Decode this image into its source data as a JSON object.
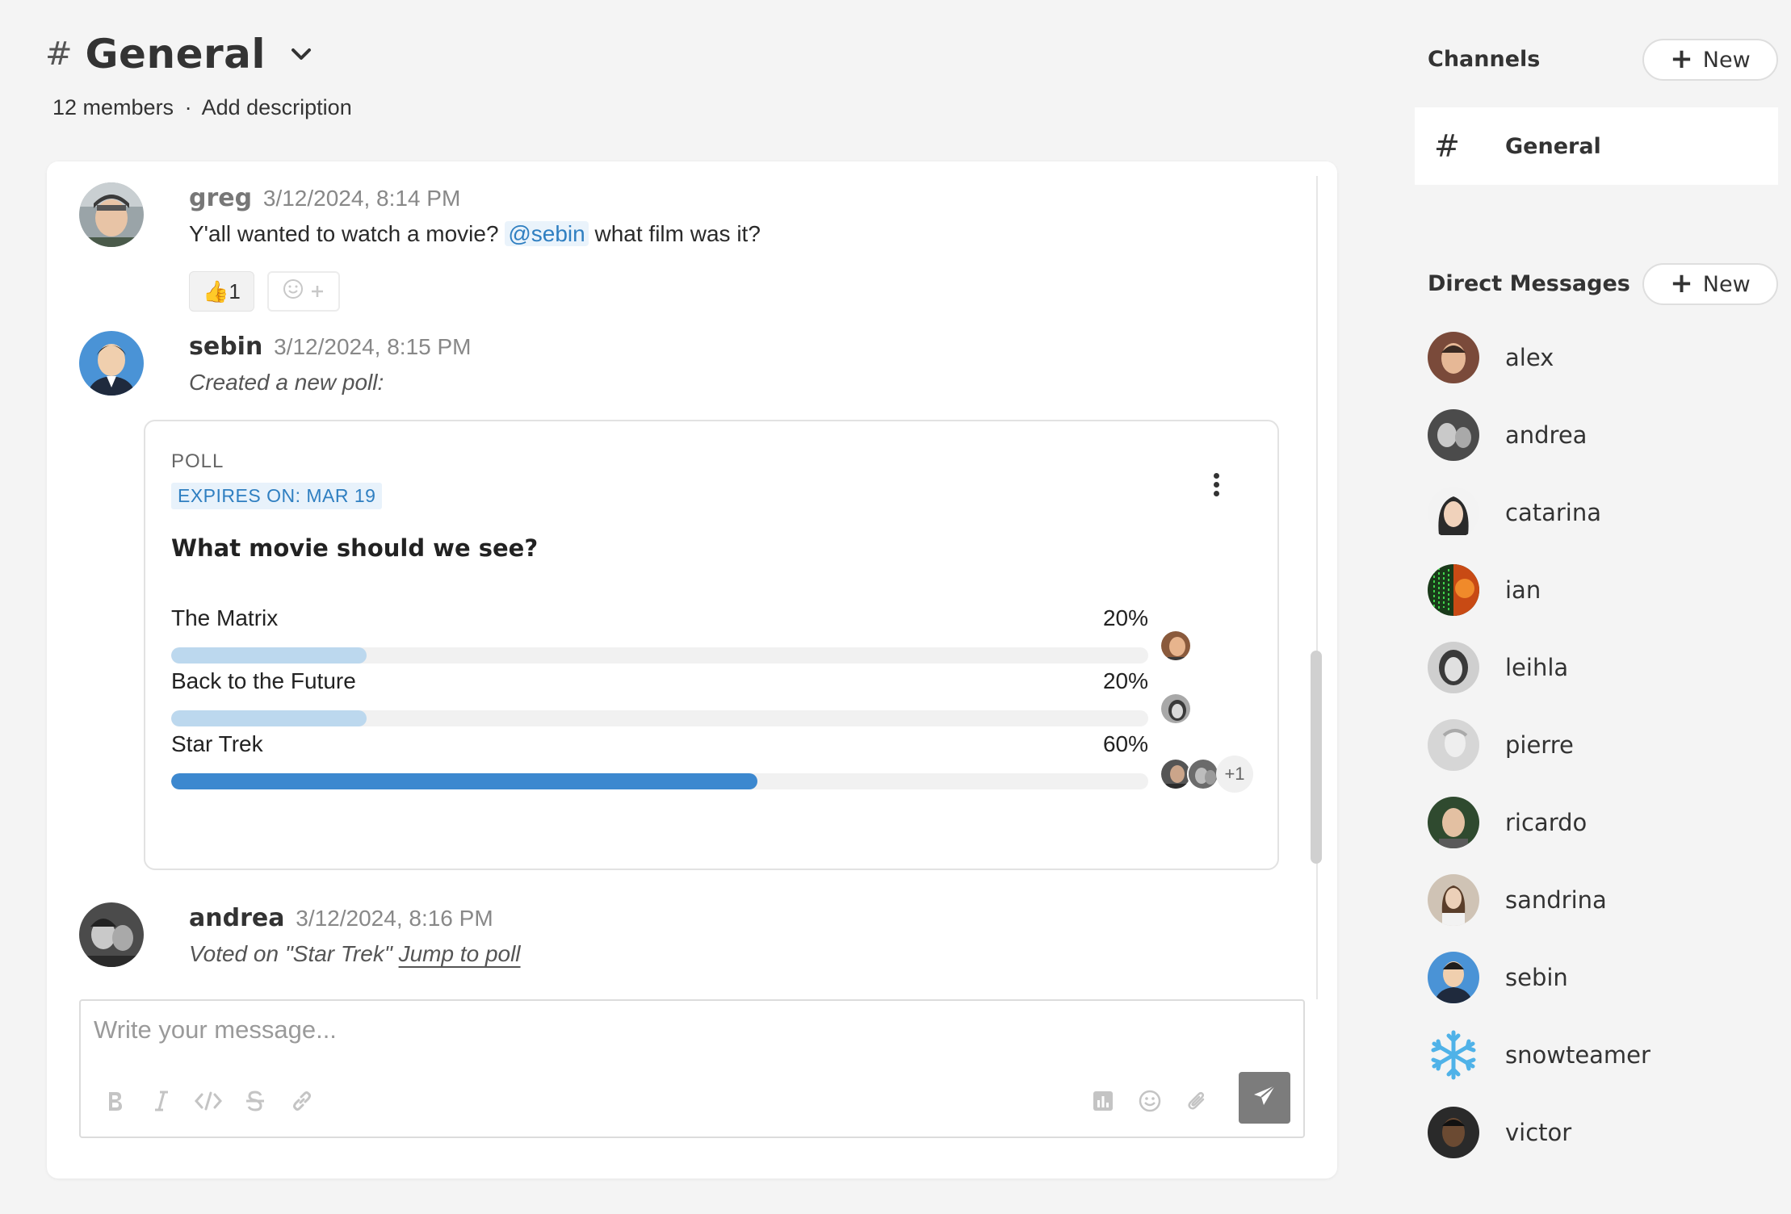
{
  "channel": {
    "hash": "#",
    "name": "General",
    "members": "12 members",
    "separator": "·",
    "add_description": "Add description"
  },
  "messages": [
    {
      "author": "greg",
      "timestamp": "3/12/2024, 8:14 PM",
      "text_before": "Y'all wanted to watch a movie?",
      "mention": "@sebin",
      "text_after": "what film was it?",
      "reaction": {
        "emoji": "👍",
        "count": "1"
      }
    },
    {
      "author": "sebin",
      "timestamp": "3/12/2024, 8:15 PM",
      "text": "Created a new poll:"
    },
    {
      "author": "andrea",
      "timestamp": "3/12/2024, 8:16 PM",
      "text": "Voted on \"Star Trek\"",
      "link": "Jump to poll"
    }
  ],
  "poll": {
    "label": "POLL",
    "expiry": "EXPIRES ON: MAR 19",
    "question": "What movie should we see?",
    "options": [
      {
        "label": "The Matrix",
        "percent_text": "20%",
        "percent": 20,
        "fill_color": "#bcd8ee"
      },
      {
        "label": "Back to the Future",
        "percent_text": "20%",
        "percent": 20,
        "fill_color": "#bcd8ee"
      },
      {
        "label": "Star Trek",
        "percent_text": "60%",
        "percent": 60,
        "fill_color": "#3c88cf",
        "more_voters": "+1"
      }
    ]
  },
  "composer": {
    "placeholder": "Write your message...",
    "tools": [
      "bold-icon",
      "italic-icon",
      "code-icon",
      "strikethrough-icon",
      "link-icon"
    ],
    "right_tools": [
      "poll-icon",
      "emoji-icon",
      "attachment-icon"
    ],
    "send_icon": "send-icon"
  },
  "sidebar": {
    "channels_title": "Channels",
    "new_label": "New",
    "channels": [
      {
        "hash": "#",
        "name": "General"
      }
    ],
    "dm_title": "Direct Messages",
    "dms": [
      "alex",
      "andrea",
      "catarina",
      "ian",
      "leihla",
      "pierre",
      "ricardo",
      "sandrina",
      "sebin",
      "snowteamer",
      "victor"
    ]
  },
  "colors": {
    "accent": "#2f7fc1",
    "bar_strong": "#3c88cf",
    "bar_light": "#bcd8ee",
    "send_button": "#7c7c7c"
  }
}
